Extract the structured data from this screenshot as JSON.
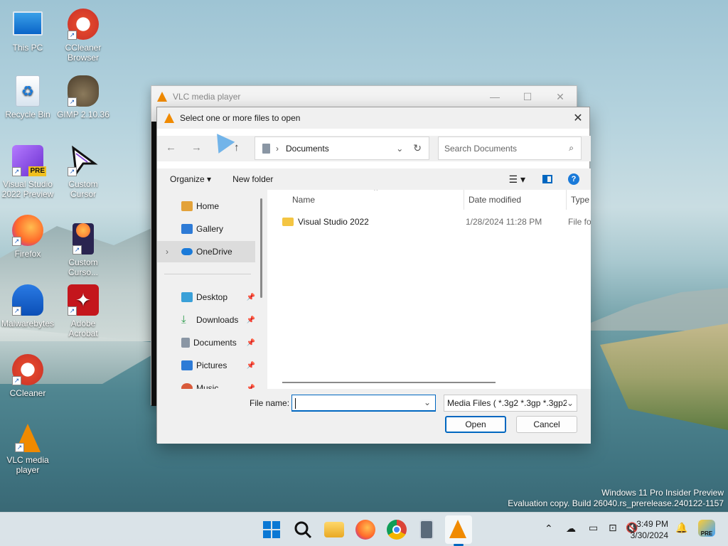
{
  "desktop": {
    "icons": [
      {
        "label": "This PC"
      },
      {
        "label": "CCleaner Browser"
      },
      {
        "label": "Recycle Bin"
      },
      {
        "label": "GIMP 2.10.36"
      },
      {
        "label": "Visual Studio 2022 Preview"
      },
      {
        "label": "Custom Cursor"
      },
      {
        "label": "Firefox"
      },
      {
        "label": "Custom Curso..."
      },
      {
        "label": "Malwarebytes"
      },
      {
        "label": "Adobe Acrobat"
      },
      {
        "label": "CCleaner"
      },
      {
        "label": "VLC media player"
      }
    ],
    "watermark_line1": "Windows 11 Pro Insider Preview",
    "watermark_line2": "Evaluation copy. Build 26040.rs_prerelease.240122-1157"
  },
  "vlc_window": {
    "title": "VLC media player"
  },
  "dialog": {
    "title": "Select one or more files to open",
    "breadcrumb": "Documents",
    "search_placeholder": "Search Documents",
    "organize_label": "Organize ▾",
    "new_folder_label": "New folder",
    "nav": [
      {
        "label": "Home"
      },
      {
        "label": "Gallery"
      },
      {
        "label": "OneDrive"
      },
      {
        "label": "Desktop"
      },
      {
        "label": "Downloads"
      },
      {
        "label": "Documents"
      },
      {
        "label": "Pictures"
      },
      {
        "label": "Music"
      }
    ],
    "columns": {
      "name": "Name",
      "date": "Date modified",
      "type": "Type"
    },
    "files": [
      {
        "name": "Visual Studio 2022",
        "date": "1/28/2024 11:28 PM",
        "type": "File fo"
      }
    ],
    "file_name_label": "File name:",
    "file_name_value": "",
    "file_type_value": "Media Files ( *.3g2 *.3gp *.3gp2",
    "open_label": "Open",
    "cancel_label": "Cancel"
  },
  "taskbar": {
    "time": "3:49 PM",
    "date": "3/30/2024",
    "apps": [
      "start-icon",
      "search-icon",
      "file-explorer-icon",
      "firefox-icon",
      "chrome-icon",
      "calculator-icon",
      "vlc-icon"
    ]
  },
  "colors": {
    "accent": "#0067c0",
    "folder": "#f4c542",
    "vlc": "#f08a00"
  }
}
